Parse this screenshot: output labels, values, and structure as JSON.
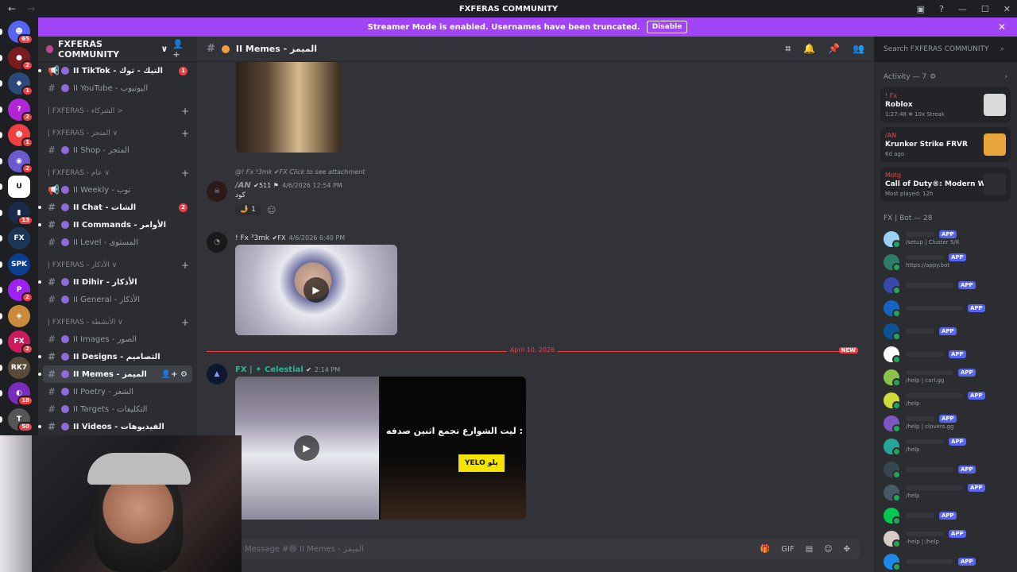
{
  "window": {
    "title": "FXFERAS COMMUNITY"
  },
  "banner": {
    "text": "Streamer Mode is enabled. Usernames have been truncated.",
    "button": "Disable"
  },
  "servers": [
    {
      "badge": "65",
      "color": "#5865f2",
      "glyph": "☻"
    },
    {
      "badge": "2",
      "color": "#7a1b22",
      "glyph": "●"
    },
    {
      "badge": "1",
      "color": "#2b4a7a",
      "glyph": "◆"
    },
    {
      "badge": "2",
      "color": "#b026d6",
      "glyph": "?"
    },
    {
      "badge": "1",
      "color": "#f23f43",
      "glyph": "☻"
    },
    {
      "badge": "2",
      "color": "#6a5acd",
      "glyph": "◉"
    },
    {
      "badge": "",
      "color": "#ffffff",
      "glyph": "U"
    },
    {
      "badge": "13",
      "color": "#1b2a4a",
      "glyph": "▮"
    },
    {
      "badge": "",
      "color": "#1d3557",
      "glyph": "FX"
    },
    {
      "badge": "",
      "color": "#0b3d91",
      "glyph": "SPK"
    },
    {
      "badge": "2",
      "color": "#a020f0",
      "glyph": "P"
    },
    {
      "badge": "",
      "color": "#c98a3b",
      "glyph": "◈"
    },
    {
      "badge": "2",
      "color": "#c81d5a",
      "glyph": "FX"
    },
    {
      "badge": "",
      "color": "#5a4a3a",
      "glyph": "RK7"
    },
    {
      "badge": "18",
      "color": "#7b2cbf",
      "glyph": "◐"
    },
    {
      "badge": "50",
      "color": "#555",
      "glyph": "T"
    }
  ],
  "sidebar": {
    "server_name": "FXFERAS COMMUNITY",
    "items": [
      {
        "type": "channel",
        "label": "II TikTok - التيك - توك",
        "badge": "1",
        "bright": true,
        "icon": "megaphone-icon"
      },
      {
        "type": "channel",
        "label": "II YouTube - اليوتيوب",
        "badge": "",
        "bright": false,
        "icon": "hash-icon"
      },
      {
        "type": "category",
        "label": "| FXFERAS - الشركاء >"
      },
      {
        "type": "category",
        "label": "| FXFERAS - المتجر ∨"
      },
      {
        "type": "channel",
        "label": "II Shop - المتجر",
        "badge": "",
        "bright": false,
        "icon": "hash-icon"
      },
      {
        "type": "category",
        "label": "| FXFERAS - عام ∨"
      },
      {
        "type": "channel",
        "label": "II Weekly - توب",
        "badge": "",
        "bright": false,
        "icon": "megaphone-icon"
      },
      {
        "type": "channel",
        "label": "II Chat - الشات",
        "badge": "2",
        "bright": true,
        "icon": "hash-icon"
      },
      {
        "type": "channel",
        "label": "II Commands - الأوامر",
        "badge": "",
        "bright": true,
        "icon": "hash-icon"
      },
      {
        "type": "channel",
        "label": "II Level - المستوى",
        "badge": "",
        "bright": false,
        "icon": "hash-icon"
      },
      {
        "type": "category",
        "label": "| FXFERAS - الأذكار ∨"
      },
      {
        "type": "channel",
        "label": "II Dihir - الأذكار",
        "badge": "",
        "bright": true,
        "icon": "hash-icon"
      },
      {
        "type": "channel",
        "label": "II General - الأذكار",
        "badge": "",
        "bright": false,
        "icon": "hash-icon"
      },
      {
        "type": "category",
        "label": "| FXFERAS - الأنشطة ∨"
      },
      {
        "type": "channel",
        "label": "II Images - الصور",
        "badge": "",
        "bright": false,
        "icon": "hash-icon"
      },
      {
        "type": "channel",
        "label": "II Designs - التصاميم",
        "badge": "",
        "bright": true,
        "icon": "hash-icon"
      },
      {
        "type": "channel",
        "label": "II Memes - الميمز",
        "badge": "",
        "bright": true,
        "selected": true,
        "icon": "hash-icon"
      },
      {
        "type": "channel",
        "label": "II Poetry - الشعر",
        "badge": "",
        "bright": false,
        "icon": "hash-icon"
      },
      {
        "type": "channel",
        "label": "II Targets - التكليفات",
        "badge": "",
        "bright": false,
        "icon": "hash-icon"
      },
      {
        "type": "channel",
        "label": "II Videos - الفيديوهات",
        "badge": "",
        "bright": true,
        "icon": "hash-icon"
      }
    ]
  },
  "channel_header": {
    "name": "II Memes - الميمز"
  },
  "search": {
    "placeholder": "Search FXFERAS COMMUNITY"
  },
  "messages": [
    {
      "reply": "@! Fx ³3mk  ✔FX  Click to see attachment",
      "author": "/AN",
      "extra": "✔511 ⚑",
      "time": "4/6/2026 12:54 PM",
      "text": "كود",
      "reaction_count": "1"
    },
    {
      "author": "! Fx ³3mk",
      "extra": "✔FX",
      "time": "4/6/2026 6:40 PM"
    },
    {
      "author": "FX | ✦ Celestial",
      "extra": "✔",
      "time": "2:14 PM",
      "caption": "ليت الشوارع تجمع اثنين صدفه :",
      "sign": "YELO يلو"
    }
  ],
  "divider": {
    "date": "April 10, 2026",
    "new_label": "NEW"
  },
  "composer": {
    "placeholder": "Message #😄 II Memes - الميمز"
  },
  "activity": {
    "header": "Activity — 7",
    "cards": [
      {
        "user": "! Fx",
        "game": "Roblox",
        "detail": "1:27:48  ⛯ 10x Streak",
        "color": "#d9d9d9"
      },
      {
        "user": "/AN",
        "game": "Krunker Strike FRVR",
        "detail": "6d ago",
        "color": "#e8a53b"
      },
      {
        "user": "Motg",
        "game": "Call of Duty®: Modern Warf...",
        "detail": "Most played: 12h",
        "color": "#2b2d31"
      }
    ]
  },
  "members": {
    "group": "FX | Bot — 28",
    "list": [
      {
        "status": "/setup | Cluster 5/8",
        "color": "#9ad0f5"
      },
      {
        "status": "https://appy.bot",
        "color": "#2e7d6b"
      },
      {
        "status": "",
        "color": "#3949ab"
      },
      {
        "status": "",
        "color": "#1565c0"
      },
      {
        "status": "",
        "color": "#0b5394"
      },
      {
        "status": "",
        "color": "#ffffff"
      },
      {
        "status": "/help | carl.gg",
        "color": "#8bc34a"
      },
      {
        "status": "/help",
        "color": "#cddc39"
      },
      {
        "status": "/help | clovers.gg",
        "color": "#7e57c2"
      },
      {
        "status": "/help",
        "color": "#26a69a"
      },
      {
        "status": "",
        "color": "#37474f"
      },
      {
        "status": "/help",
        "color": "#455a64"
      },
      {
        "status": "",
        "color": "#00c853"
      },
      {
        "status": "-help | /help",
        "color": "#d7ccc8"
      },
      {
        "status": "",
        "color": "#1e88e5"
      }
    ],
    "app_tag": "APP"
  }
}
